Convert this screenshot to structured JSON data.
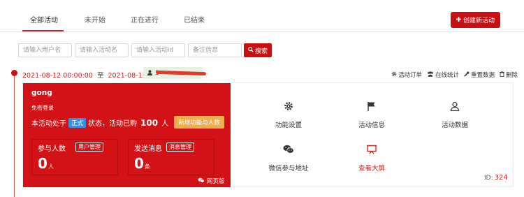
{
  "tabs": [
    {
      "label": "全部活动",
      "active": true
    },
    {
      "label": "未开始",
      "active": false
    },
    {
      "label": "正在进行",
      "active": false
    },
    {
      "label": "已结束",
      "active": false
    }
  ],
  "create_button": {
    "label": "创建新活动",
    "icon": "plus-icon"
  },
  "filters": {
    "username_placeholder": "请输入用户名",
    "activity_name_placeholder": "请输入活动名",
    "activity_id_placeholder": "请输入活动id",
    "remark_placeholder": "备注信息",
    "search_label": "搜索"
  },
  "activity": {
    "start": "2021-08-12 00:00:00",
    "to": "至",
    "end": "2021-08-13 00:00:00",
    "owner_prefix": "1",
    "actions": [
      {
        "label": "活动订单",
        "icon": "gear-icon"
      },
      {
        "label": "在线统计",
        "icon": "users-icon"
      },
      {
        "label": "重置数据",
        "icon": "wrench-icon"
      },
      {
        "label": "删除",
        "icon": "trash-icon"
      }
    ],
    "title": "gong",
    "subtitle": "免密登录",
    "status_prefix": "本活动处于",
    "status_badge": "正式",
    "status_middle": "状态，活动已购",
    "bought_count": "100",
    "bought_unit": "人",
    "new_feature_label": "新增功能与人数",
    "participants": {
      "label": "参与人数",
      "tag": "用户管理",
      "value": "0",
      "unit": "人"
    },
    "messages": {
      "label": "发送消息",
      "tag": "消息管理",
      "value": "0",
      "unit": "条"
    },
    "web_version": "网页版",
    "features": [
      {
        "label": "功能设置",
        "icon": "gear-icon"
      },
      {
        "label": "活动信息",
        "icon": "flag-icon"
      },
      {
        "label": "活动数据",
        "icon": "user-icon"
      },
      {
        "label": "微信参与地址",
        "icon": "wechat-icon"
      },
      {
        "label": "查看大屏",
        "icon": "screen-icon"
      }
    ],
    "id_label": "ID:",
    "id_value": "324"
  },
  "colors": {
    "accent": "#c80f11",
    "card_bg": "#d31217",
    "badge": "#3a8fd8",
    "new_feature": "#f0ad4e"
  }
}
